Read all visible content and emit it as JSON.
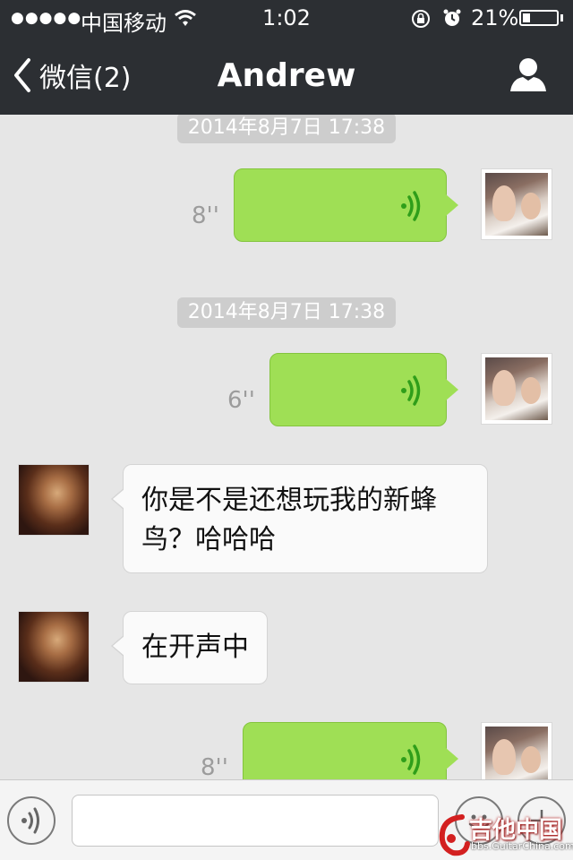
{
  "status_bar": {
    "signal": "●●●●●",
    "carrier": "中国移动",
    "time": "1:02",
    "battery": "21%",
    "battery_level": 0.21,
    "icons": [
      "wifi-icon",
      "rotation-lock-icon",
      "alarm-icon",
      "battery-icon"
    ]
  },
  "header": {
    "back_label": "微信(2)",
    "title": "Andrew",
    "icons": [
      "chevron-left-icon",
      "profile-icon"
    ]
  },
  "messages": [
    {
      "type": "timestamp",
      "text": "2014年8月7日 17:38"
    },
    {
      "type": "voice",
      "from": "me",
      "duration": "8''"
    },
    {
      "type": "timestamp",
      "text": "2014年8月7日 17:38"
    },
    {
      "type": "voice",
      "from": "me",
      "duration": "6''"
    },
    {
      "type": "text",
      "from": "other",
      "lines": [
        "你是不是还想玩我的新蜂",
        "鸟？哈哈哈"
      ]
    },
    {
      "type": "text",
      "from": "other",
      "lines": [
        "在开声中"
      ]
    },
    {
      "type": "voice",
      "from": "me",
      "duration": "8''"
    }
  ],
  "input_bar": {
    "icons": [
      "voice-mode-icon",
      "emoji-icon",
      "plus-icon"
    ],
    "text_value": ""
  },
  "watermark": {
    "text": "吉他中国",
    "sub": "bbs.GuitarChina.com"
  },
  "colors": {
    "nav_bg": "#2c2f33",
    "chat_bg": "#e6e6e6",
    "voice_bubble": "#9fdf55",
    "voice_wave": "#2f9e1a",
    "text_bubble": "#fafafa"
  }
}
